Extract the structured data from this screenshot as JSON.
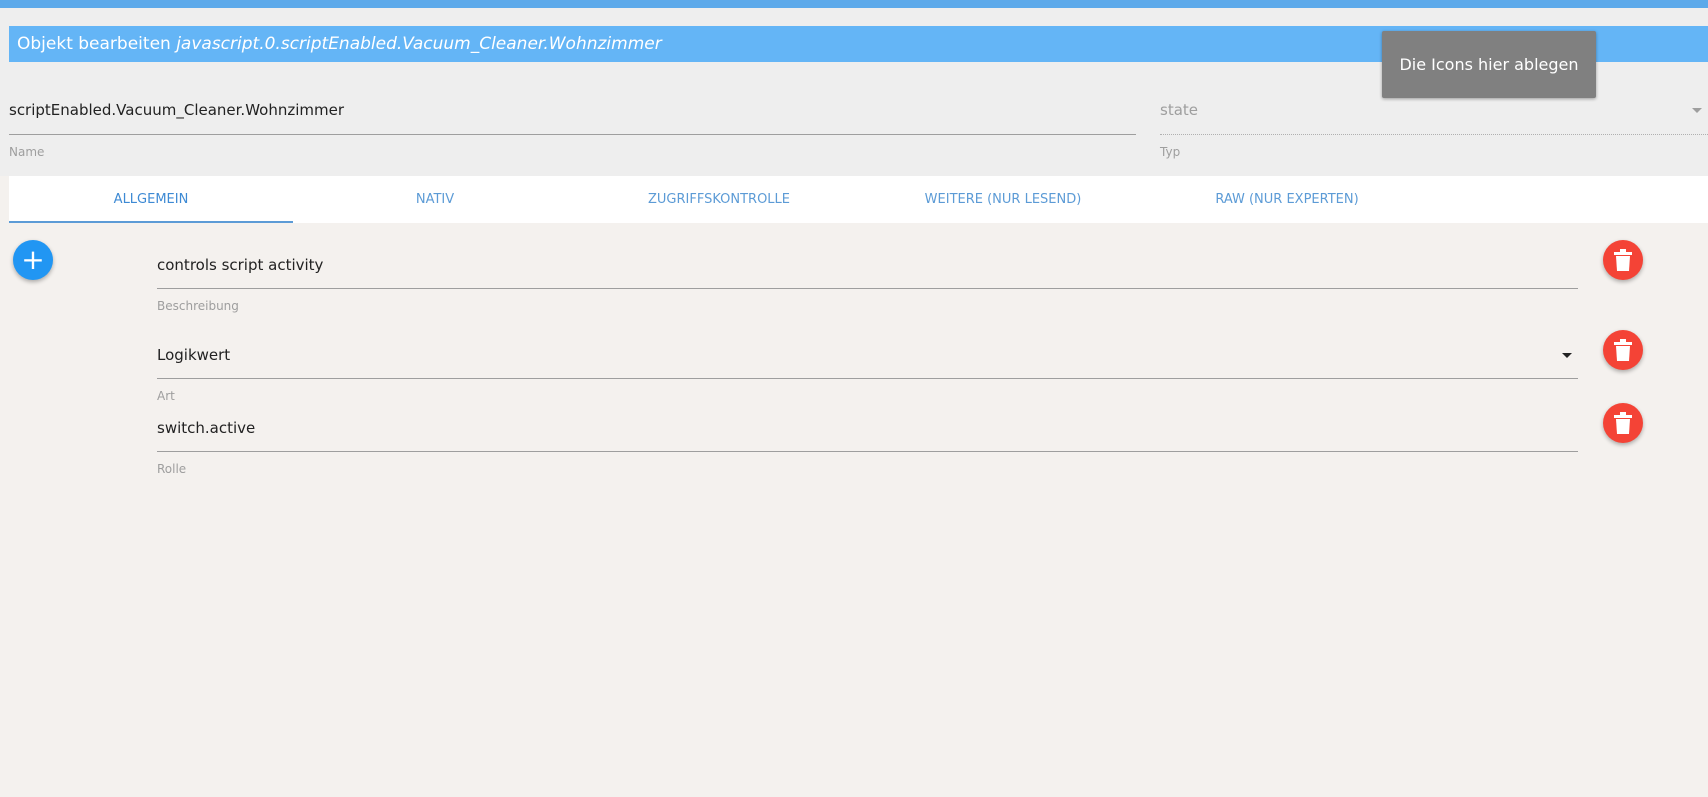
{
  "dialog": {
    "title_prefix": "Objekt bearbeiten",
    "title_object_id": "javascript.0.scriptEnabled.Vacuum_Cleaner.Wohnzimmer",
    "drop_zone_text": "Die Icons hier ablegen"
  },
  "header_fields": {
    "name_value": "scriptEnabled.Vacuum_Cleaner.Wohnzimmer",
    "name_label": "Name",
    "type_value": "state",
    "type_label": "Typ"
  },
  "tabs": [
    {
      "label": "Allgemein",
      "active": true
    },
    {
      "label": "Nativ",
      "active": false
    },
    {
      "label": "Zugriffskontrolle",
      "active": false
    },
    {
      "label": "Weitere (nur lesend)",
      "active": false
    },
    {
      "label": "Raw (nur Experten)",
      "active": false
    }
  ],
  "add_button": {
    "glyph": "+",
    "icon": "plus-icon"
  },
  "properties": [
    {
      "value": "controls script activity",
      "label": "Beschreibung",
      "delete_icon": "trash-icon"
    },
    {
      "value": "Logikwert",
      "label": "Art",
      "delete_icon": "trash-icon"
    },
    {
      "value": "switch.active",
      "label": "Rolle",
      "delete_icon": "trash-icon"
    }
  ],
  "colors": {
    "title_bar": "#64b5f6",
    "tab_text": "#5c9bd6",
    "add_button": "#2196f3",
    "delete_button": "#f44336",
    "drop_zone": "#808080"
  }
}
